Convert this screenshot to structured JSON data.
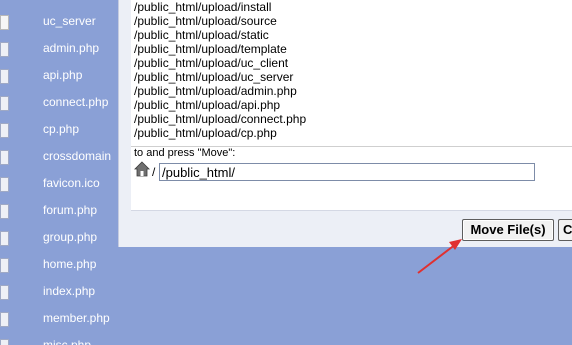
{
  "file_list": [
    {
      "name": "uc_server",
      "type": "dir"
    },
    {
      "name": "admin.php",
      "type": "file"
    },
    {
      "name": "api.php",
      "type": "file"
    },
    {
      "name": "connect.php",
      "type": "file"
    },
    {
      "name": "cp.php",
      "type": "file"
    },
    {
      "name": "crossdomain",
      "type": "file"
    },
    {
      "name": "favicon.ico",
      "type": "file"
    },
    {
      "name": "forum.php",
      "type": "file"
    },
    {
      "name": "group.php",
      "type": "file"
    },
    {
      "name": "home.php",
      "type": "file"
    },
    {
      "name": "index.php",
      "type": "file"
    },
    {
      "name": "member.php",
      "type": "file"
    },
    {
      "name": "misc.php",
      "type": "file"
    }
  ],
  "move_dialog": {
    "paths": [
      "/public_html/upload/install",
      "/public_html/upload/source",
      "/public_html/upload/static",
      "/public_html/upload/template",
      "/public_html/upload/uc_client",
      "/public_html/upload/uc_server",
      "/public_html/upload/admin.php",
      "/public_html/upload/api.php",
      "/public_html/upload/connect.php",
      "/public_html/upload/cp.php"
    ],
    "instruction": "to and press \"Move\":",
    "path_prefix": "/",
    "destination_value": "/public_html/",
    "move_button_label": "Move File(s)",
    "cancel_button_label": "C"
  },
  "colors": {
    "background": "#8aa0d6",
    "arrow": "#e03030"
  }
}
